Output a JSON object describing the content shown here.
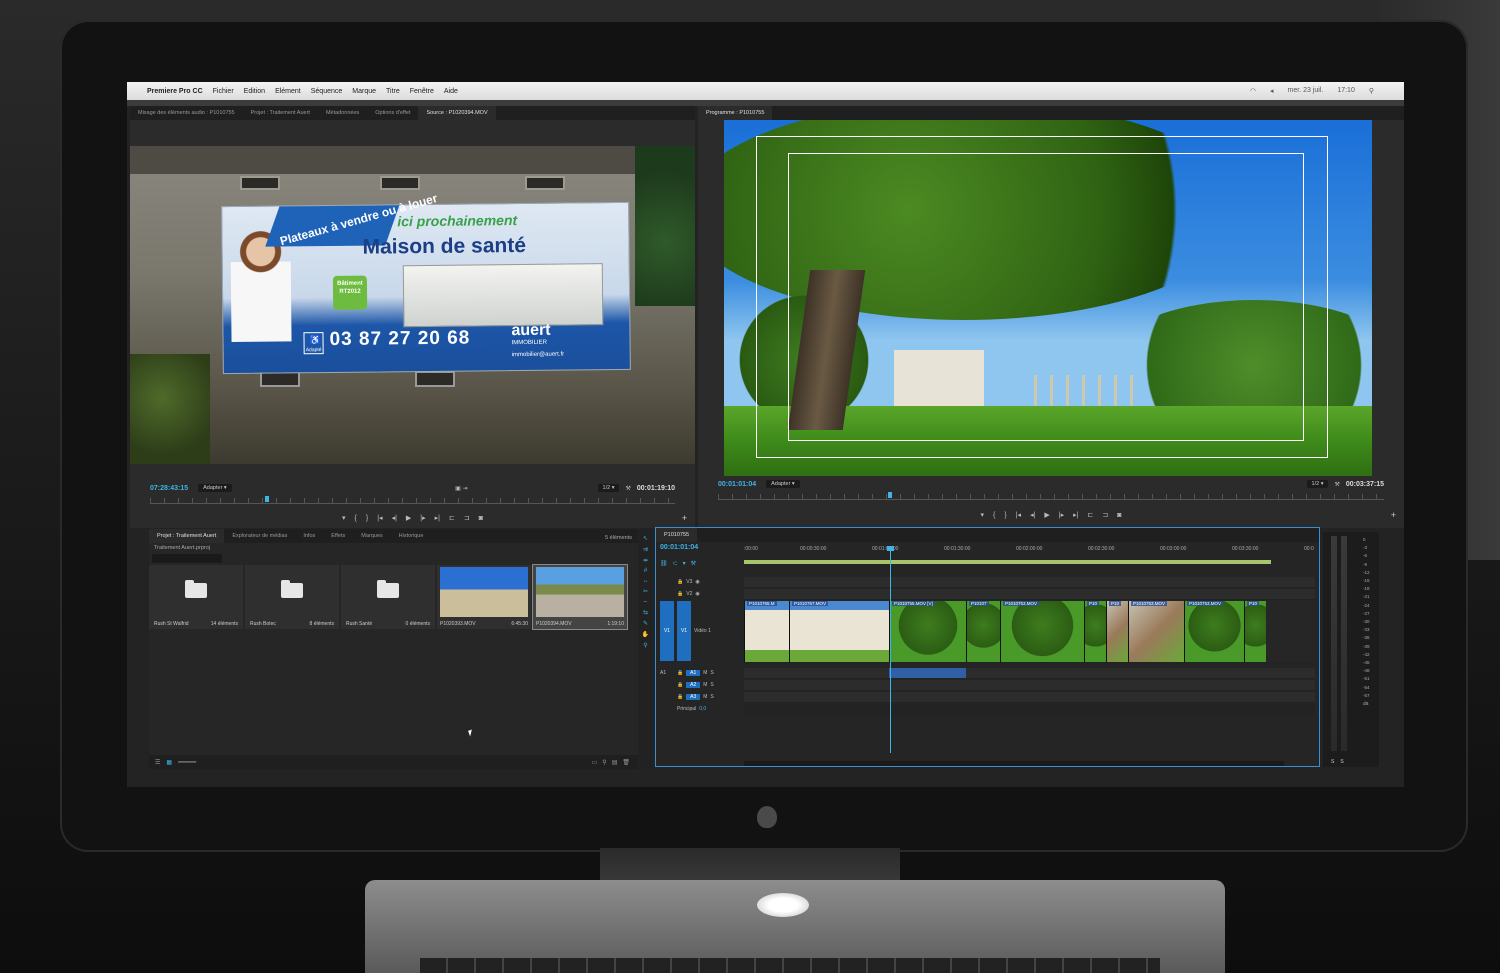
{
  "menubar": {
    "app": "Premiere Pro CC",
    "items": [
      "Fichier",
      "Edition",
      "Elément",
      "Séquence",
      "Marque",
      "Titre",
      "Fenêtre",
      "Aide"
    ],
    "clock": "17:10",
    "date": "mer. 23 juil."
  },
  "source_panel": {
    "tabs": [
      "Mixage des éléments audio : P1010755",
      "Projet : Traitement Auert",
      "Métadonnées",
      "Options d'effet",
      "Source : P1020394.MOV"
    ],
    "active_tab": 4,
    "timecode_in": "07:28:43:15",
    "fit": "Adapter",
    "resolution": "1/2",
    "duration": "00:01:19:10",
    "banner": {
      "plateaux": "Plateaux à vendre ou à louer",
      "ici": "ici prochainement",
      "maison": "Maison de santé",
      "rt": "Bâtiment RT2012",
      "phone": "03 87 27 20 68",
      "brand": "auert",
      "brand_sub": "IMMOBILIER",
      "email": "immobilier@auert.fr",
      "adapte": "Adapté"
    }
  },
  "program_panel": {
    "title": "Programme : P1010755",
    "timecode_in": "00:01:01:04",
    "fit": "Adapter",
    "resolution": "1/2",
    "duration": "00:03:37:15"
  },
  "project_panel": {
    "tabs": [
      "Projet : Traitement Auert",
      "Explorateur de médias",
      "Infos",
      "Effets",
      "Marques",
      "Historique"
    ],
    "file": "Traitement Auert.prproj",
    "count": "5 éléments",
    "bins": [
      {
        "name": "Rush St Walfrid",
        "count": "14 éléments"
      },
      {
        "name": "Rush Botec",
        "count": "8 éléments"
      },
      {
        "name": "Rush Santé",
        "count": "0 éléments"
      }
    ],
    "clips": [
      {
        "name": "P1020393.MOV",
        "duration": "6:45:30"
      },
      {
        "name": "P1020394.MOV",
        "duration": "1:19:10"
      }
    ]
  },
  "timeline": {
    "sequence": "P1010755",
    "timecode": "00:01:01:04",
    "ruler": [
      ":00:00",
      "00:00:30:00",
      "00:01:00:00",
      "00:01:30:00",
      "00:02:00:00",
      "00:02:30:00",
      "00:03:00:00",
      "00:03:30:00",
      "00:0"
    ],
    "video_tracks": [
      "V3",
      "V2",
      "V1"
    ],
    "v1_name": "Vidéo 1",
    "audio_tracks": [
      "A1",
      "A2",
      "A3"
    ],
    "master": "Principal",
    "master_value": "0,0",
    "clips": [
      "P1010765.M",
      "P1010767.MOV",
      "P1010755.MOV [V]",
      "P10107",
      "P1010753.MOV",
      "P10",
      "P10",
      "P1010753.MOV",
      "P1010753.MOV",
      "P10"
    ]
  },
  "meters": {
    "scale": [
      "0",
      "-3",
      "-6",
      "-9",
      "-12",
      "-15",
      "-18",
      "-21",
      "-24",
      "-27",
      "-30",
      "-33",
      "-36",
      "-39",
      "-42",
      "-45",
      "-48",
      "-51",
      "-54",
      "-57",
      "dB"
    ],
    "solo": [
      "S",
      "S"
    ]
  },
  "colors": {
    "accent": "#3fb4e8",
    "panel": "#2b2b2b",
    "track_target": "#1f6fc0"
  }
}
